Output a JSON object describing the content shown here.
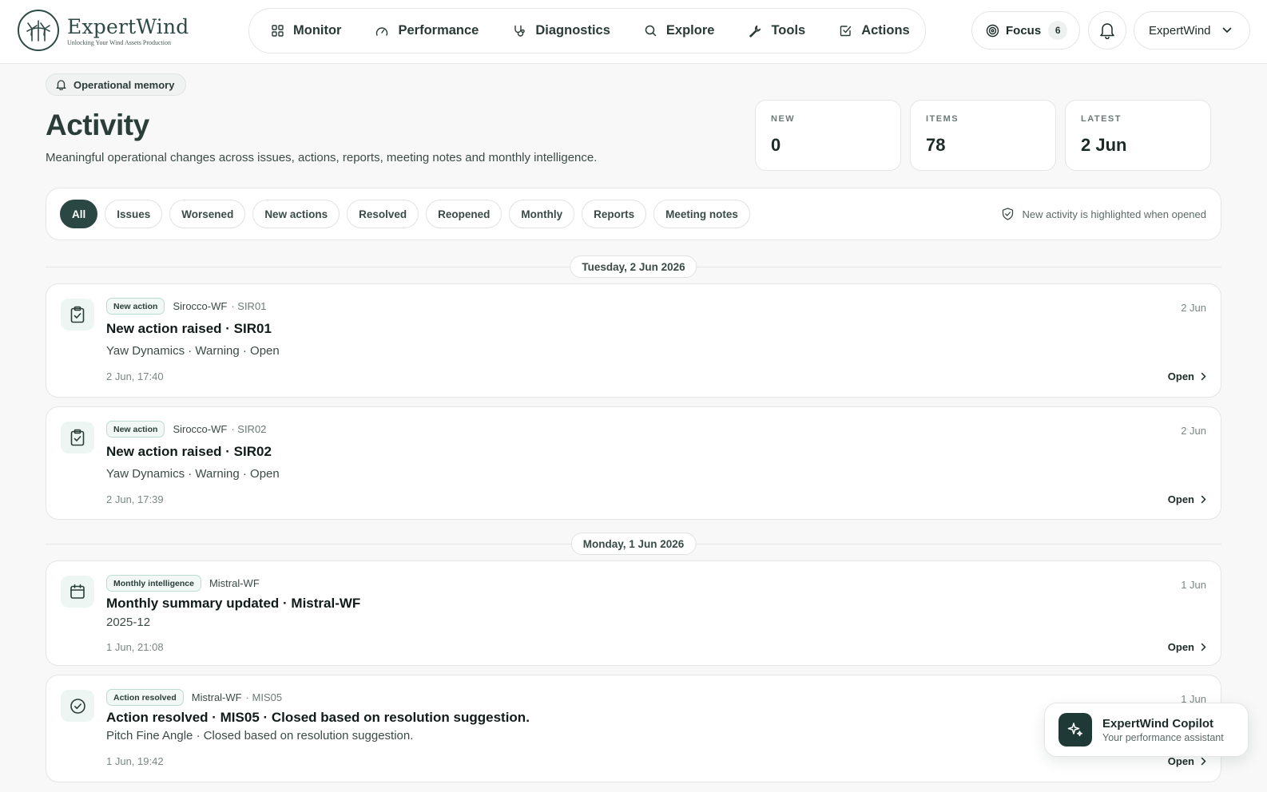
{
  "header": {
    "brand_name": "ExpertWind",
    "brand_tagline": "Unlocking Your Wind Assets Production",
    "nav": [
      {
        "label": "Monitor",
        "icon": "grid-icon"
      },
      {
        "label": "Performance",
        "icon": "gauge-icon"
      },
      {
        "label": "Diagnostics",
        "icon": "stethoscope-icon"
      },
      {
        "label": "Explore",
        "icon": "search-icon"
      },
      {
        "label": "Tools",
        "icon": "wrench-icon"
      },
      {
        "label": "Actions",
        "icon": "checkbox-icon"
      }
    ],
    "focus_label": "Focus",
    "focus_count": "6",
    "account_label": "ExpertWind"
  },
  "page": {
    "badge": "Operational memory",
    "title": "Activity",
    "subtitle": "Meaningful operational changes across issues, actions, reports, meeting notes and monthly intelligence."
  },
  "stats": [
    {
      "label": "NEW",
      "value": "0"
    },
    {
      "label": "ITEMS",
      "value": "78"
    },
    {
      "label": "LATEST",
      "value": "2 Jun"
    }
  ],
  "filters": {
    "chips": [
      "All",
      "Issues",
      "Worsened",
      "New actions",
      "Resolved",
      "Reopened",
      "Monthly",
      "Reports",
      "Meeting notes"
    ],
    "active": "All",
    "hint": "New activity is highlighted when opened"
  },
  "groups": [
    {
      "date_label": "Tuesday, 2 Jun 2026",
      "items": [
        {
          "tag": "New action",
          "farm": "Sirocco-WF",
          "turbine": "· SIR01",
          "title": "New action raised · SIR01",
          "detail": "Yaw Dynamics · Warning · Open",
          "time": "2 Jun, 17:40",
          "date": "2 Jun",
          "open": "Open",
          "icon": "clipboard-check-icon"
        },
        {
          "tag": "New action",
          "farm": "Sirocco-WF",
          "turbine": "· SIR02",
          "title": "New action raised · SIR02",
          "detail": "Yaw Dynamics · Warning · Open",
          "time": "2 Jun, 17:39",
          "date": "2 Jun",
          "open": "Open",
          "icon": "clipboard-check-icon"
        }
      ]
    },
    {
      "date_label": "Monday, 1 Jun 2026",
      "items": [
        {
          "tag": "Monthly intelligence",
          "farm": "Mistral-WF",
          "turbine": "",
          "title": "Monthly summary updated · Mistral-WF",
          "detail": "2025-12",
          "time": "1 Jun, 21:08",
          "date": "1 Jun",
          "open": "Open",
          "icon": "calendar-icon"
        },
        {
          "tag": "Action resolved",
          "farm": "Mistral-WF",
          "turbine": "· MIS05",
          "title": "Action resolved · MIS05 · Closed based on resolution suggestion.",
          "detail": "Pitch Fine Angle · Closed based on resolution suggestion.",
          "time": "1 Jun, 19:42",
          "date": "1 Jun",
          "open": "Open",
          "icon": "check-circle-icon"
        }
      ]
    }
  ],
  "copilot": {
    "name": "ExpertWind Copilot",
    "subtitle": "Your performance assistant"
  }
}
